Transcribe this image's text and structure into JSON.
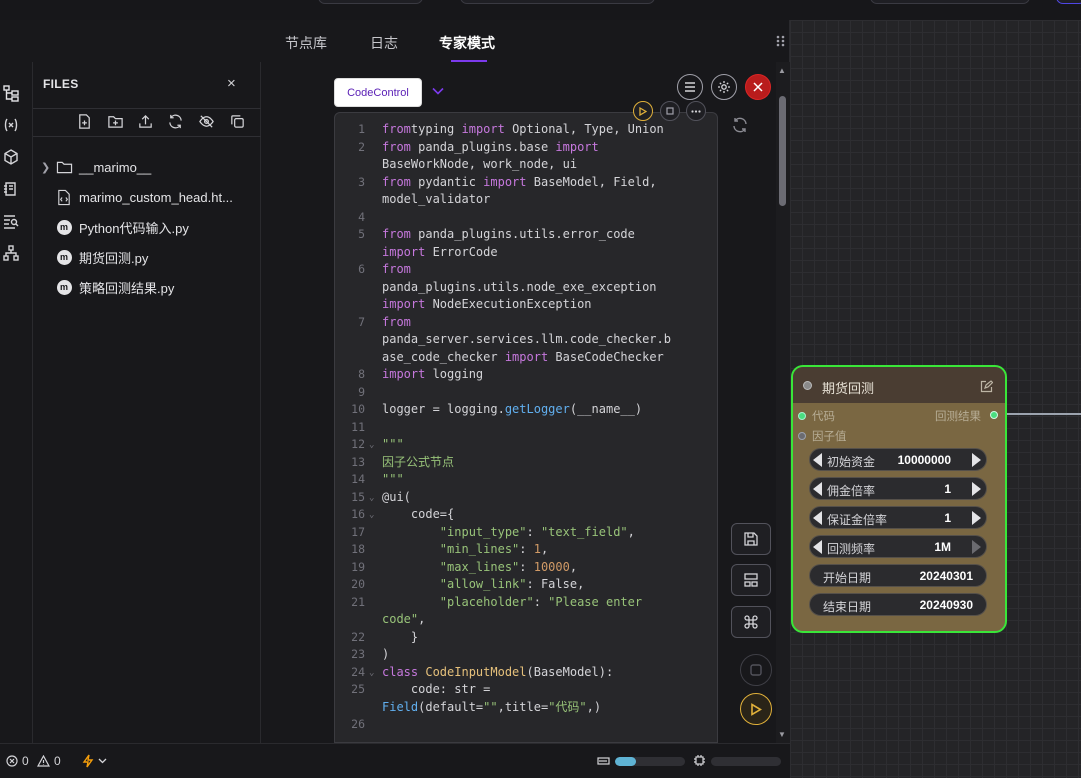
{
  "tabs": [
    {
      "label": "节点库"
    },
    {
      "label": "日志"
    },
    {
      "label": "专家模式",
      "active": true
    }
  ],
  "sidebar": {
    "title": "FILES",
    "close": "×",
    "items": [
      {
        "name": "__marimo__",
        "type": "folder"
      },
      {
        "name": "marimo_custom_head.ht...",
        "type": "html"
      },
      {
        "name": "Python代码输入.py",
        "type": "marimo"
      },
      {
        "name": "期货回测.py",
        "type": "marimo"
      },
      {
        "name": "策略回测结果.py",
        "type": "marimo"
      }
    ],
    "toolbar_icons": [
      "new-file-icon",
      "new-folder-icon",
      "upload-icon",
      "refresh-icon",
      "hide-icon",
      "copy-icon"
    ]
  },
  "activity_icons": [
    "files-tree-icon",
    "variables-icon",
    "package-icon",
    "notebook-icon",
    "outline-search-icon",
    "graph-icon"
  ],
  "editor": {
    "mode_button": "CodeControl",
    "icon_m": "m",
    "lines": [
      {
        "n": "1",
        "tokens": [
          [
            "kw",
            "from"
          ],
          [
            "",
            "typing"
          ],
          [
            "kw",
            " import"
          ],
          [
            "",
            " Optional, Type, Union"
          ]
        ]
      },
      {
        "n": "2",
        "tokens": [
          [
            "kw",
            "from"
          ],
          [
            "",
            ""
          ],
          [
            "",
            " panda_plugins.base"
          ],
          [
            "kw",
            " import"
          ]
        ]
      },
      {
        "n": "",
        "tokens": [
          [
            "",
            "BaseWorkNode, work_node, ui"
          ]
        ]
      },
      {
        "n": "3",
        "tokens": [
          [
            "kw",
            "from"
          ],
          [
            "",
            " pydantic"
          ],
          [
            "kw",
            " import"
          ],
          [
            "",
            " BaseModel, Field,"
          ]
        ]
      },
      {
        "n": "",
        "tokens": [
          [
            "",
            "model_validator"
          ]
        ]
      },
      {
        "n": "4",
        "tokens": []
      },
      {
        "n": "5",
        "tokens": [
          [
            "kw",
            "from"
          ],
          [
            "",
            " panda_plugins.utils.error_code"
          ]
        ]
      },
      {
        "n": "",
        "tokens": [
          [
            "kw",
            "import"
          ],
          [
            "",
            " ErrorCode"
          ]
        ]
      },
      {
        "n": "6",
        "tokens": [
          [
            "kw",
            "from"
          ]
        ]
      },
      {
        "n": "",
        "tokens": [
          [
            "",
            "panda_plugins.utils.node_exe_exception"
          ]
        ]
      },
      {
        "n": "",
        "tokens": [
          [
            "kw",
            "import"
          ],
          [
            "",
            " NodeExecutionException"
          ]
        ]
      },
      {
        "n": "7",
        "tokens": [
          [
            "kw",
            "from"
          ]
        ]
      },
      {
        "n": "",
        "tokens": [
          [
            "",
            "panda_server.services.llm.code_checker.b"
          ]
        ]
      },
      {
        "n": "",
        "tokens": [
          [
            "",
            "ase_code_checker"
          ],
          [
            "kw",
            " import"
          ],
          [
            "",
            " BaseCodeChecker"
          ]
        ]
      },
      {
        "n": "8",
        "tokens": [
          [
            "kw",
            "import"
          ],
          [
            "",
            " logging"
          ]
        ]
      },
      {
        "n": "9",
        "tokens": []
      },
      {
        "n": "10",
        "tokens": [
          [
            "",
            "logger = logging."
          ],
          [
            "fn",
            "getLogger"
          ],
          [
            "",
            "(__name__)"
          ]
        ]
      },
      {
        "n": "11",
        "tokens": []
      },
      {
        "n": "12",
        "fold": true,
        "tokens": [
          [
            "st",
            "\"\"\""
          ]
        ]
      },
      {
        "n": "13",
        "tokens": [
          [
            "st",
            "因子公式节点"
          ]
        ]
      },
      {
        "n": "14",
        "tokens": [
          [
            "st",
            "\"\"\""
          ]
        ]
      },
      {
        "n": "15",
        "fold": true,
        "tokens": [
          [
            "",
            "@ui("
          ]
        ]
      },
      {
        "n": "16",
        "fold": true,
        "tokens": [
          [
            "",
            "    code={"
          ]
        ]
      },
      {
        "n": "17",
        "tokens": [
          [
            "st",
            "        \"input_type\""
          ],
          [
            "",
            ": "
          ],
          [
            "st",
            "\"text_field\""
          ],
          [
            "",
            ","
          ]
        ]
      },
      {
        "n": "18",
        "tokens": [
          [
            "st",
            "        \"min_lines\""
          ],
          [
            "",
            ": "
          ],
          [
            "nm",
            "1"
          ],
          [
            "",
            ","
          ]
        ]
      },
      {
        "n": "19",
        "tokens": [
          [
            "st",
            "        \"max_lines\""
          ],
          [
            "",
            ": "
          ],
          [
            "nm",
            "10000"
          ],
          [
            "",
            ","
          ]
        ]
      },
      {
        "n": "20",
        "tokens": [
          [
            "st",
            "        \"allow_link\""
          ],
          [
            "",
            ": False,"
          ]
        ]
      },
      {
        "n": "21",
        "tokens": [
          [
            "st",
            "        \"placeholder\""
          ],
          [
            "",
            ": "
          ],
          [
            "st",
            "\"Please enter"
          ]
        ]
      },
      {
        "n": "",
        "tokens": [
          [
            "st",
            "code\""
          ],
          [
            "",
            ","
          ]
        ]
      },
      {
        "n": "22",
        "tokens": [
          [
            "",
            "    }"
          ]
        ]
      },
      {
        "n": "23",
        "tokens": [
          [
            "",
            ")"
          ]
        ]
      },
      {
        "n": "24",
        "fold": true,
        "tokens": [
          [
            "kw",
            "class"
          ],
          [
            "cls",
            " CodeInputModel"
          ],
          [
            "",
            "(BaseModel):"
          ]
        ]
      },
      {
        "n": "25",
        "tokens": [
          [
            "",
            "    code: str ="
          ]
        ]
      },
      {
        "n": "",
        "tokens": [
          [
            "fn",
            "Field"
          ],
          [
            "",
            "(default="
          ],
          [
            "st",
            "\"\""
          ],
          [
            "",
            ",title="
          ],
          [
            "st",
            "\"代码\""
          ],
          [
            "",
            ",)"
          ]
        ]
      },
      {
        "n": "26",
        "tokens": []
      }
    ]
  },
  "status": {
    "errors": "0",
    "warnings": "0",
    "progress": 0.3
  },
  "node": {
    "title": "期货回测",
    "inputs": [
      "代码",
      "因子值"
    ],
    "output": "回测结果",
    "params": [
      {
        "label": "初始资金",
        "value": "10000000"
      },
      {
        "label": "佣金倍率",
        "value": "1"
      },
      {
        "label": "保证金倍率",
        "value": "1"
      },
      {
        "label": "回测频率",
        "value": "1M"
      }
    ],
    "dates": [
      {
        "label": "开始日期",
        "value": "20240301"
      },
      {
        "label": "结束日期",
        "value": "20240930"
      }
    ]
  },
  "colors": {
    "accent": "#7c3aed",
    "node_border": "#39e639",
    "node_body": "#7a6742",
    "run": "#e0b03a"
  }
}
